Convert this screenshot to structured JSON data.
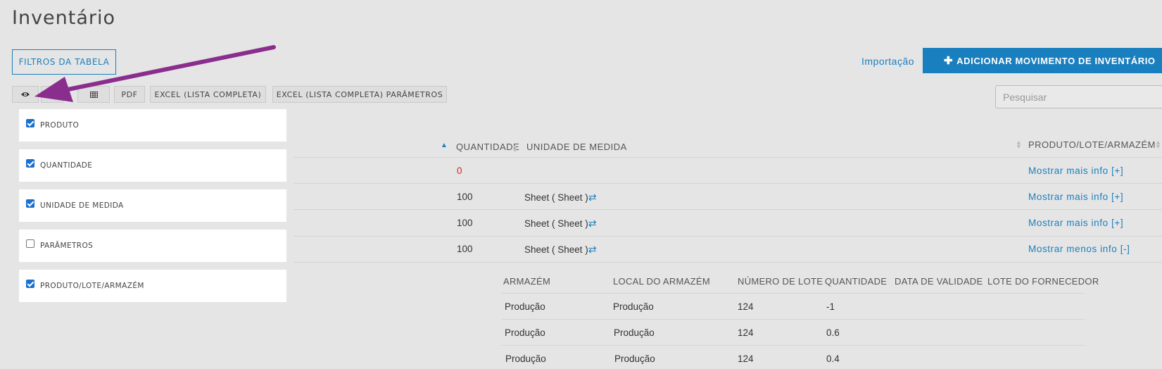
{
  "page": {
    "title": "Inventário"
  },
  "toolbar": {
    "filters_label": "FILTROS DA TABELA",
    "import_label": "Importação",
    "add_label": "ADICIONAR MOVIMENTO DE INVENTÁRIO",
    "pdf_label": "PDF",
    "excel_label": "EXCEL (LISTA COMPLETA)",
    "excel_params_label": "EXCEL (LISTA COMPLETA) PARÂMETROS",
    "search_placeholder": "Pesquisar"
  },
  "columns_panel": {
    "items": [
      {
        "label": "PRODUTO",
        "checked": true
      },
      {
        "label": "QUANTIDADE",
        "checked": true
      },
      {
        "label": "UNIDADE DE MEDIDA",
        "checked": true
      },
      {
        "label": "PARÂMETROS",
        "checked": false
      },
      {
        "label": "PRODUTO/LOTE/ARMAZÉM",
        "checked": true
      }
    ]
  },
  "table": {
    "headers": {
      "quantity": "QUANTIDADE",
      "unit": "UNIDADE DE MEDIDA",
      "product_lot": "PRODUTO/LOTE/ARMAZÉM"
    },
    "rows": [
      {
        "quantity": "0",
        "unit": "",
        "link": "Mostrar mais info [+]"
      },
      {
        "quantity": "100",
        "unit": "Sheet ( Sheet )",
        "link": "Mostrar mais info [+]"
      },
      {
        "quantity": "100",
        "unit": "Sheet ( Sheet )",
        "link": "Mostrar mais info [+]"
      },
      {
        "quantity": "100",
        "unit": "Sheet ( Sheet )",
        "link": "Mostrar menos info [-]"
      }
    ]
  },
  "subtable": {
    "headers": {
      "warehouse": "ARMAZÉM",
      "location": "LOCAL DO ARMAZÉM",
      "lot": "NÚMERO DE LOTE",
      "quantity": "QUANTIDADE",
      "expiry": "DATA DE VALIDADE",
      "supplier_lot": "LOTE DO FORNECEDOR"
    },
    "rows": [
      {
        "warehouse": "Produção",
        "location": "Produção",
        "lot": "124",
        "quantity": "-1"
      },
      {
        "warehouse": "Produção",
        "location": "Produção",
        "lot": "124",
        "quantity": "0.6"
      },
      {
        "warehouse": "Produção",
        "location": "Produção",
        "lot": "124",
        "quantity": "0.4"
      }
    ]
  },
  "icons": {
    "columns_toggle": "eye-icon",
    "table_view": "table-icon",
    "add": "plus-icon",
    "swap": "swap-icon",
    "annotation": "arrow-annotation"
  },
  "colors": {
    "accent": "#1a7fbf",
    "negative": "#e02020",
    "annotation": "#8a2e8e"
  }
}
